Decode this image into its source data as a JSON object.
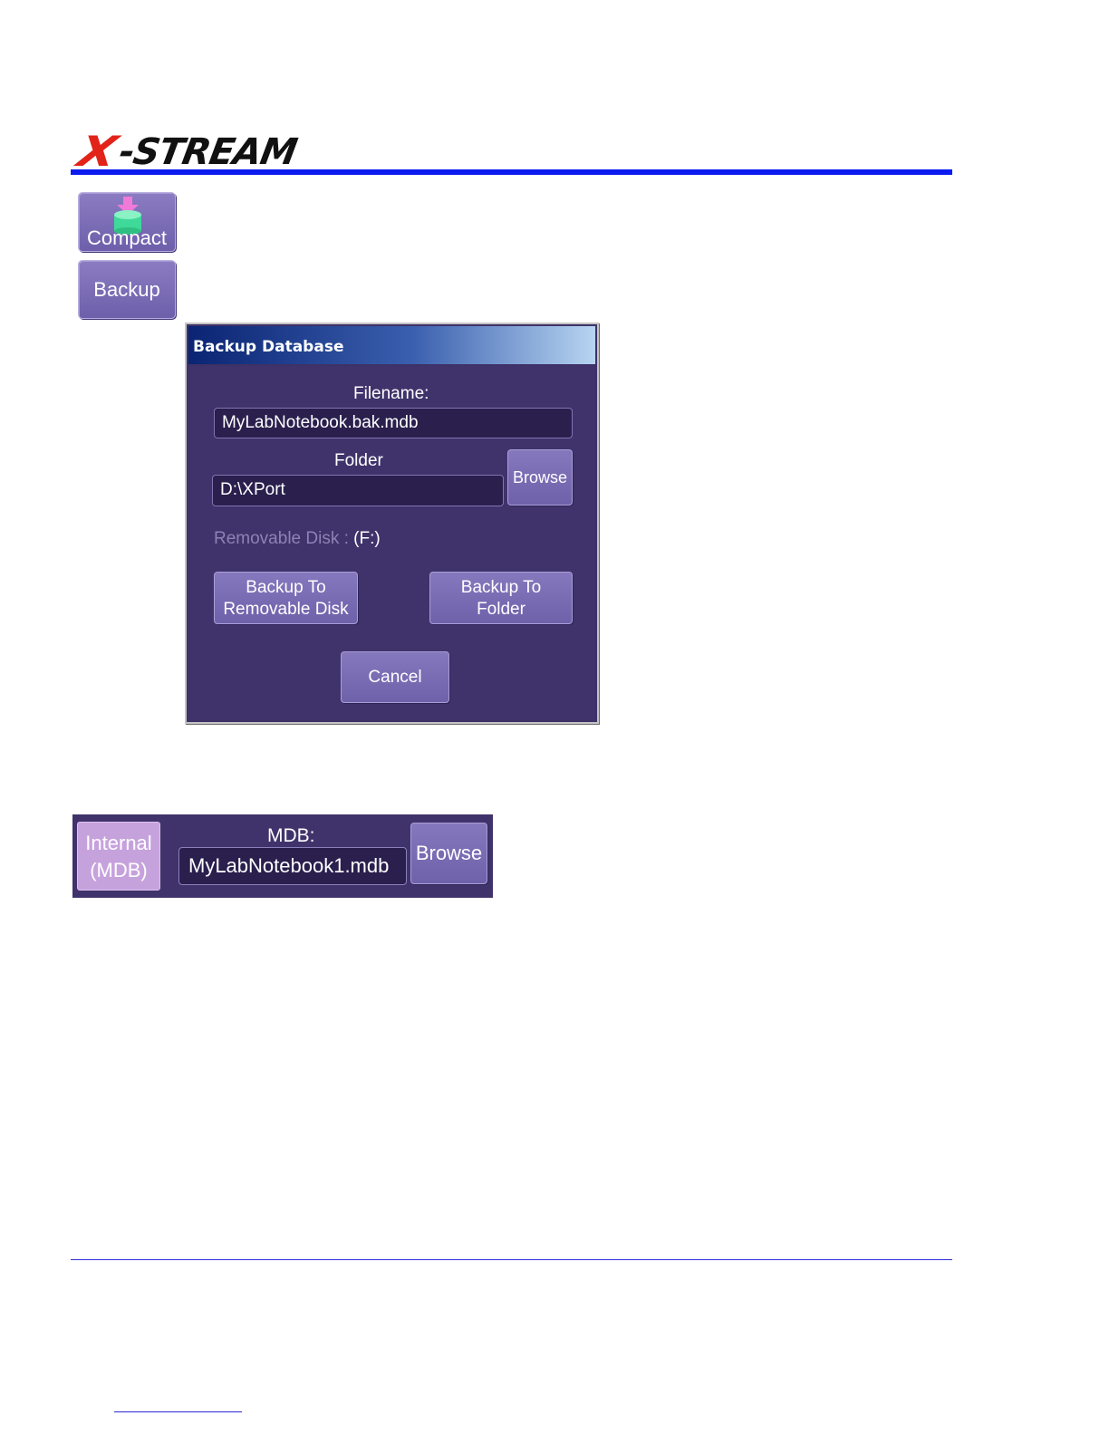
{
  "header": {
    "logo_x": "X",
    "logo_rest": "-STREAM"
  },
  "buttons": {
    "compact_label": "Compact",
    "compact_icon": "database-compact-icon",
    "backup_label": "Backup"
  },
  "dialog": {
    "title": "Backup Database",
    "filename_label": "Filename:",
    "filename_value": "MyLabNotebook.bak.mdb",
    "folder_label": "Folder",
    "folder_value": "D:\\XPort",
    "browse_label": "Browse",
    "removable_label": "Removable Disk :",
    "removable_value": "(F:)",
    "backup_removable_line1": "Backup To",
    "backup_removable_line2": "Removable Disk",
    "backup_folder_line1": "Backup To",
    "backup_folder_line2": "Folder",
    "cancel_label": "Cancel"
  },
  "mdb_strip": {
    "internal_line1": "Internal",
    "internal_line2": "(MDB)",
    "mdb_label": "MDB:",
    "mdb_value": "MyLabNotebook1.mdb",
    "browse_label": "Browse"
  },
  "colors": {
    "accent_rule": "#0b1bf0",
    "logo_red": "#e2231a",
    "dialog_bg": "#40336b",
    "button_bg": "#7a6bb4",
    "internal_button_bg": "#c6a2dd"
  }
}
